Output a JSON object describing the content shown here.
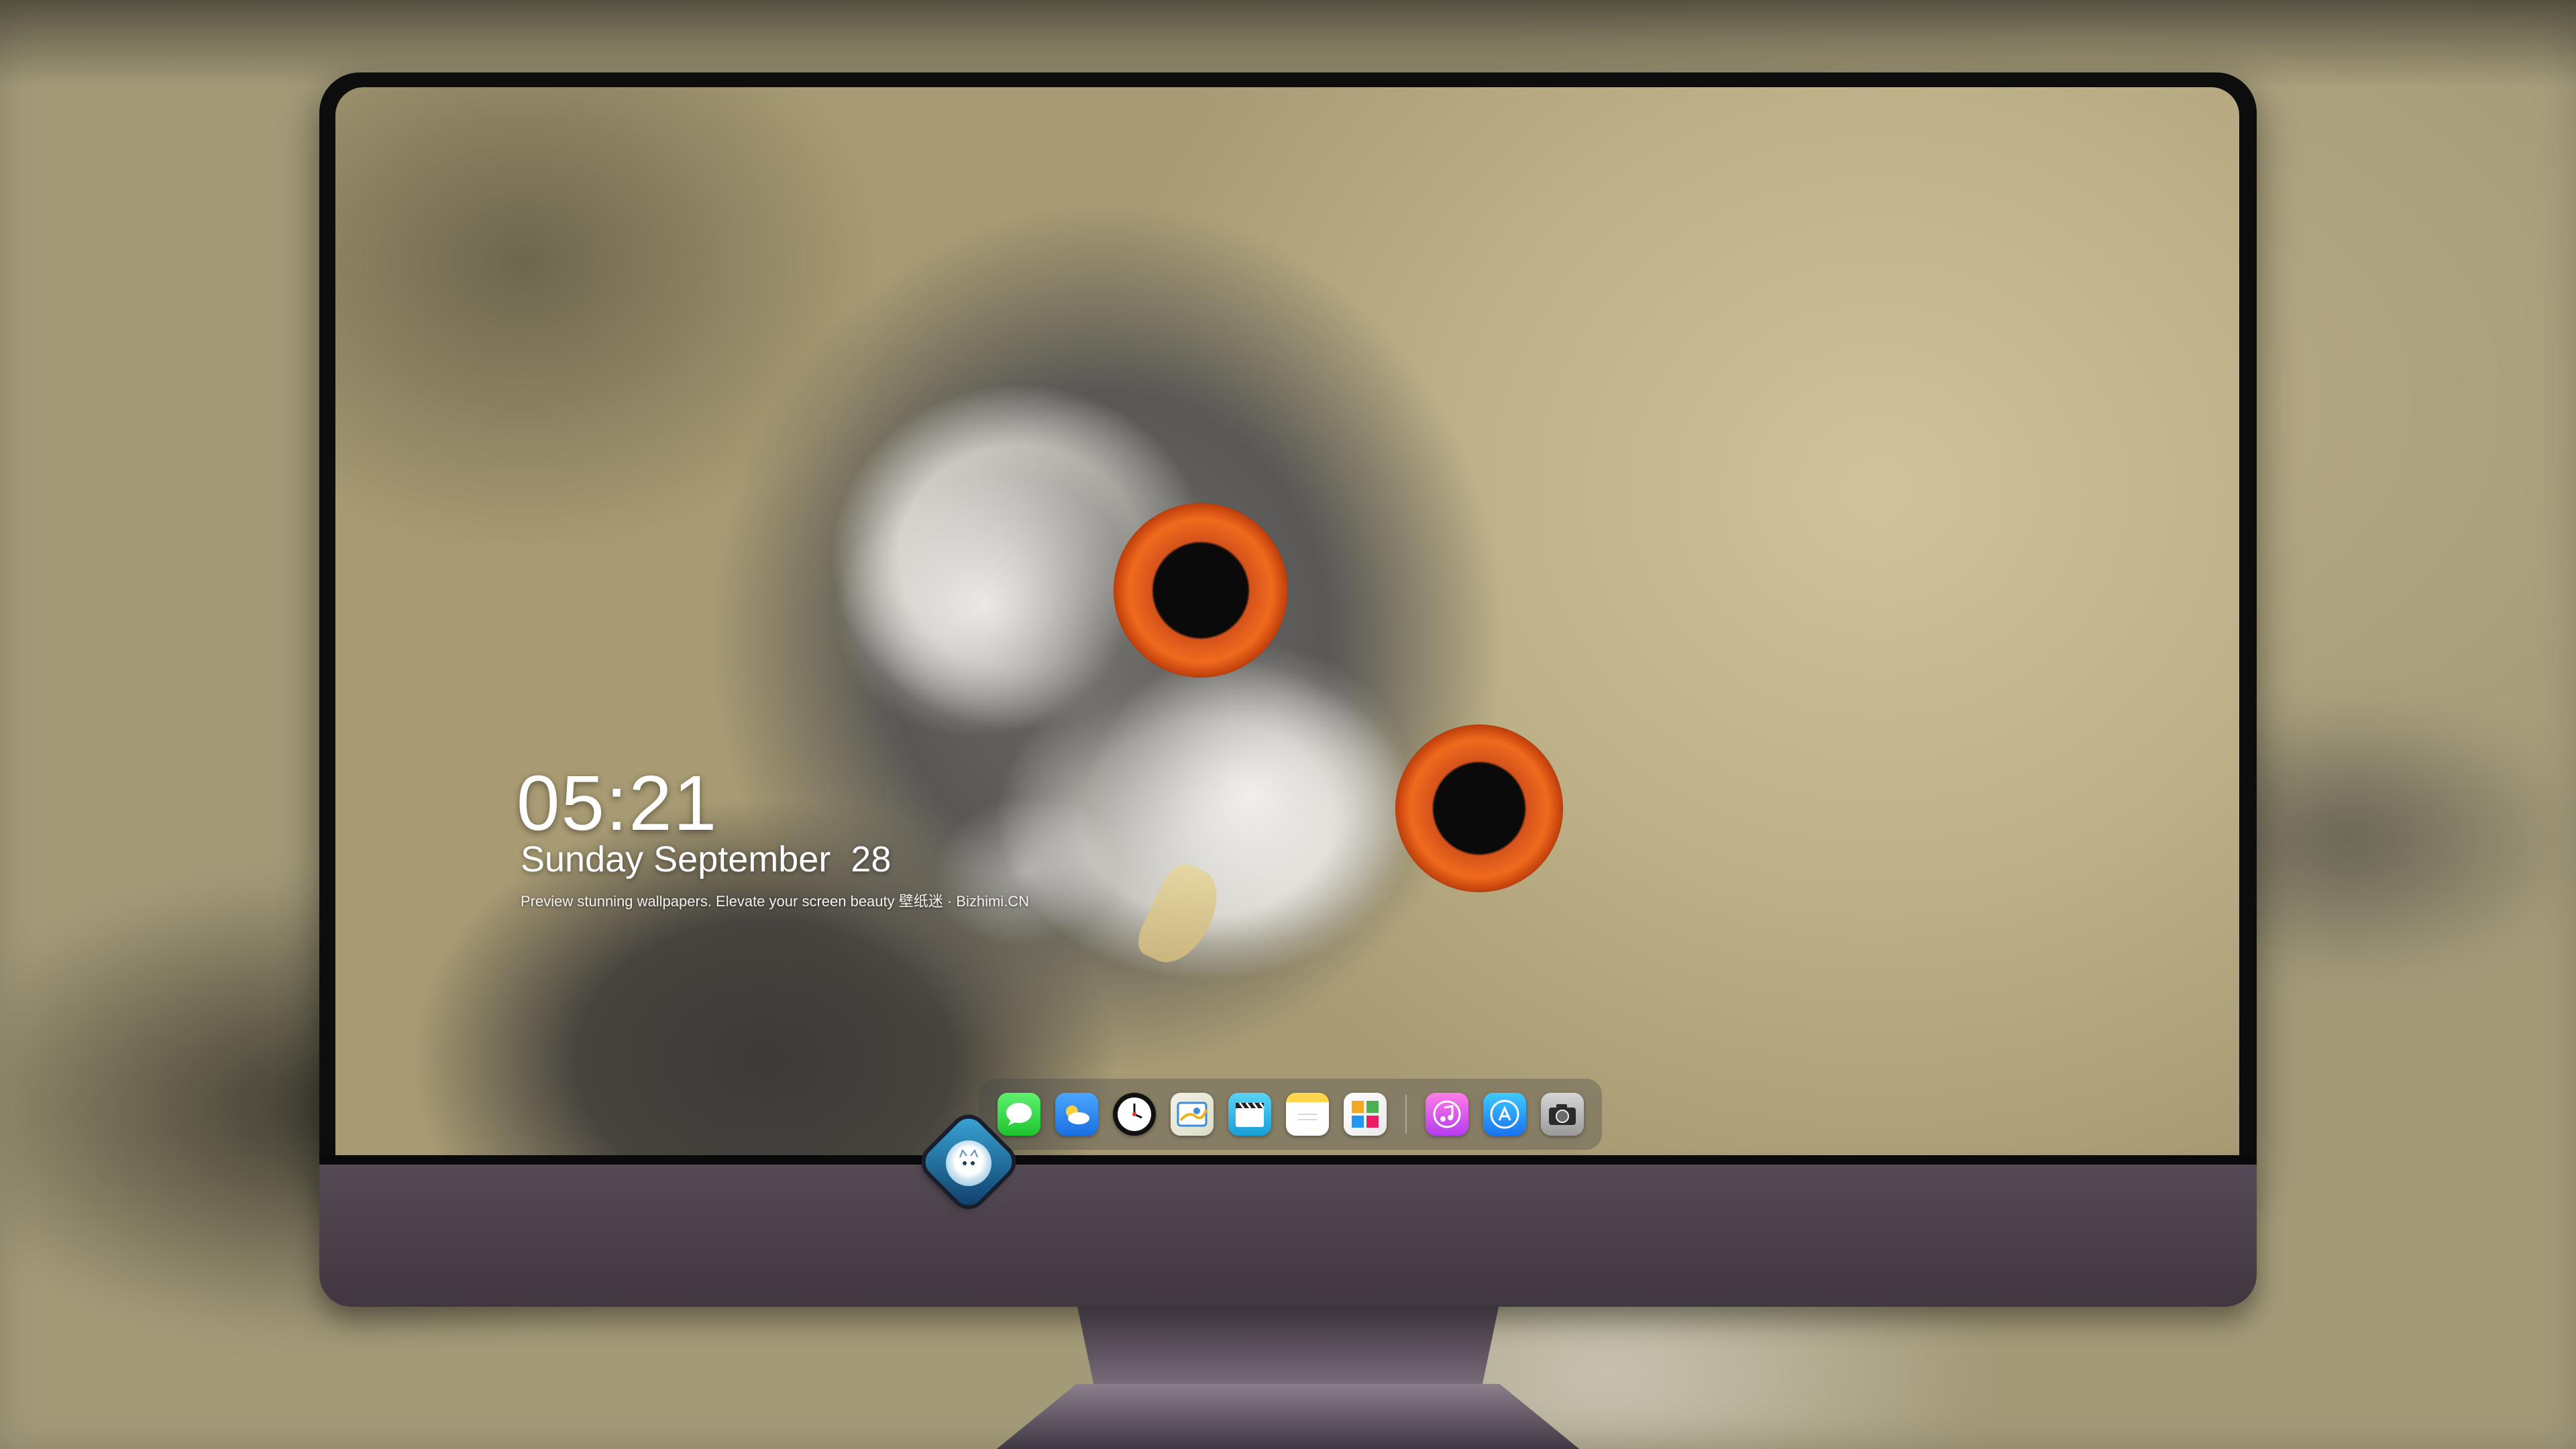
{
  "lockscreen": {
    "time": "05:21",
    "date": "Sunday September  28",
    "tagline": "Preview stunning wallpapers. Elevate your screen beauty  壁纸迷 · Bizhimi.CN"
  },
  "dock": {
    "apps": [
      {
        "name": "messages-icon",
        "glyph": "💬"
      },
      {
        "name": "weather-icon",
        "glyph": "⛅"
      },
      {
        "name": "clock-icon",
        "glyph": "🕒"
      },
      {
        "name": "maps-icon",
        "glyph": "🗺"
      },
      {
        "name": "clips-icon",
        "glyph": "🎬"
      },
      {
        "name": "notes-icon",
        "glyph": ""
      },
      {
        "name": "photos-icon",
        "glyph": "🖼"
      },
      {
        "name": "music-icon",
        "glyph": "♫"
      },
      {
        "name": "app-store-icon",
        "glyph": "A"
      },
      {
        "name": "camera-icon",
        "glyph": "📷"
      }
    ]
  },
  "colors": {
    "chin": "#4a414b",
    "bezel": "#0d0d0e"
  }
}
